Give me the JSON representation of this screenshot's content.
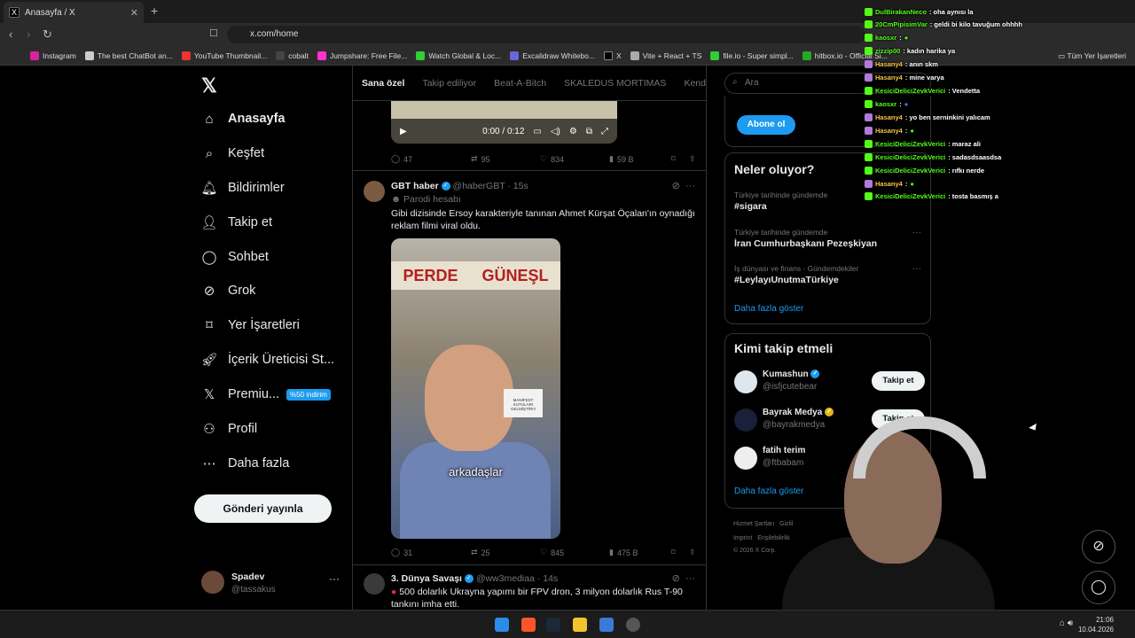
{
  "browser": {
    "tab_title": "Anasayfa / X",
    "tab_icon": "x-logo-icon",
    "url": "x.com/home",
    "bookmarks": [
      "Instagram",
      "The best ChatBot an...",
      "YouTube Thumbnail...",
      "cobalt",
      "Jumpshare: Free File...",
      "Watch Global & Loc...",
      "Excalidraw Whitebo...",
      "X",
      "Vite + React + TS",
      "file.io - Super simpl...",
      "hitbox.io - Official Si..."
    ],
    "bookmarks_all": "Tüm Yer İşaretleri"
  },
  "sidebar": {
    "items": [
      {
        "label": "Anasayfa",
        "icon": "home-icon"
      },
      {
        "label": "Keşfet",
        "icon": "search-icon"
      },
      {
        "label": "Bildirimler",
        "icon": "bell-icon"
      },
      {
        "label": "Takip et",
        "icon": "person-add-icon"
      },
      {
        "label": "Sohbet",
        "icon": "chat-icon"
      },
      {
        "label": "Grok",
        "icon": "grok-icon"
      },
      {
        "label": "Yer İşaretleri",
        "icon": "bookmark-icon"
      },
      {
        "label": "İçerik Üreticisi St...",
        "icon": "rocket-icon"
      },
      {
        "label": "Premiu...",
        "icon": "x-logo-icon"
      },
      {
        "label": "Profil",
        "icon": "person-icon"
      },
      {
        "label": "Daha fazla",
        "icon": "more-circle-icon"
      }
    ],
    "premium_badge": "%50 indirim",
    "post_button": "Gönderi yayınla",
    "account": {
      "name": "Spadev",
      "handle": "@tassakus"
    }
  },
  "feed": {
    "tabs": [
      "Sana özel",
      "Takip ediliyor",
      "Beat-A-Bitch",
      "SKALEDUS MORTIMAS",
      "Kend"
    ],
    "video1": {
      "time": "0:00 / 0:12"
    },
    "tweet0_stats": {
      "replies": "47",
      "reposts": "95",
      "likes": "834",
      "views": "59 B"
    },
    "tweet1": {
      "name": "GBT haber",
      "handle": "@haberGBT",
      "time": "· 15s",
      "label": "Parodi hesabı",
      "text": "Gibi dizisinde Ersoy karakteriyle tanınan Ahmet Kürşat Öçalan'ın oynadığı reklam filmi viral oldu.",
      "video_sign_left": "PERDE",
      "video_sign_right": "GÜNEŞL",
      "video_caption": "arkadaşlar",
      "paper_text": "MANİFEST KUTULARI GELMİŞTİR!!!",
      "stats": {
        "replies": "31",
        "reposts": "25",
        "likes": "845",
        "views": "475 B"
      }
    },
    "tweet2": {
      "name": "3. Dünya Savaşı",
      "handle": "@ww3mediaa",
      "time": "· 14s",
      "text": "500 dolarlık Ukrayna yapımı bir FPV dron, 3 milyon dolarlık Rus T-90 tankını imha etti."
    }
  },
  "right": {
    "search_placeholder": "Ara",
    "subscribe_button": "Abone ol",
    "trends_title": "Neler oluyor?",
    "trends": [
      {
        "meta": "Türkiye tarihinde gündemde",
        "name": "#sigara"
      },
      {
        "meta": "Türkiye tarihinde gündemde",
        "name": "İran Cumhurbaşkanı Pezeşkiyan"
      },
      {
        "meta": "İş dünyası ve finans · Gündemdekiler",
        "name": "#LeylayıUnutmaTürkiye"
      }
    ],
    "show_more": "Daha fazla göster",
    "who_title": "Kimi takip etmeli",
    "who": [
      {
        "name": "Kumashun",
        "handle": "@isfjcutebear",
        "button": "Takip et",
        "color": "#dfe7ee"
      },
      {
        "name": "Bayrak Medya",
        "handle": "@bayrakmedya",
        "button": "Takip et",
        "color": "#1a1f3a"
      },
      {
        "name": "fatih terim",
        "handle": "@ftbabam",
        "button": "",
        "color": "#eeeeee"
      }
    ],
    "footer": [
      "Hizmet Şartları",
      "Gizlil",
      "Imprint",
      "Erişilebilirlik",
      "© 2026 X Corp."
    ]
  },
  "chat": [
    {
      "user": "DulBirakanNeco",
      "text": ": oha aynısı la"
    },
    {
      "user": "20CmPipisimVar",
      "text": ": geldi bi kilo tavuğum ohhhh"
    },
    {
      "user": "kaosxr",
      "text": ":"
    },
    {
      "user": "zizzip00",
      "text": ": kadın harika ya"
    },
    {
      "user": "Hasany4",
      "text": ": anın skm"
    },
    {
      "user": "Hasany4",
      "text": ": mine varya"
    },
    {
      "user": "KesiciDeliciZevkVerici",
      "text": ": Vendetta"
    },
    {
      "user": "kaosxr",
      "text": ":"
    },
    {
      "user": "Hasany4",
      "text": ": yo ben serninkini yalıcam"
    },
    {
      "user": "Hasany4",
      "text": ":"
    },
    {
      "user": "KesiciDeliciZevkVerici",
      "text": ": maraz ali"
    },
    {
      "user": "KesiciDeliciZevkVerici",
      "text": ": sadasdsaasdsa"
    },
    {
      "user": "KesiciDeliciZevkVerici",
      "text": ": rıfkı nerde"
    },
    {
      "user": "Hasany4",
      "text": ":"
    },
    {
      "user": "KesiciDeliciZevkVerici",
      "text": ": tosta basmış a"
    }
  ],
  "taskbar": {
    "time": "21:06",
    "date": "10.04.2026"
  },
  "colors": {
    "accent": "#1d9bf0",
    "kick_green": "#53fc18",
    "background": "#000000"
  }
}
